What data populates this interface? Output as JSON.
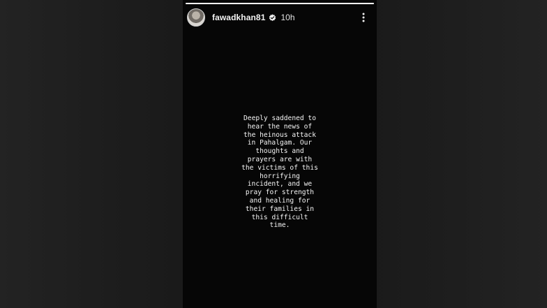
{
  "story": {
    "username": "fawadkhan81",
    "timestamp": "10h",
    "verified": true,
    "progress": 1.0,
    "menu_icon": "more-vertical-icon",
    "avatar_icon": "profile-avatar",
    "text": "Deeply saddened to\nhear the news of\nthe heinous attack\nin Pahalgam. Our\nthoughts and\nprayers are with\nthe victims of this\nhorrifying\nincident, and we\npray for strength\nand healing for\ntheir families in\nthis difficult\ntime."
  },
  "colors": {
    "story_background": "#060606",
    "page_background": "#1a1a1a",
    "text": "#f5f5f5"
  }
}
